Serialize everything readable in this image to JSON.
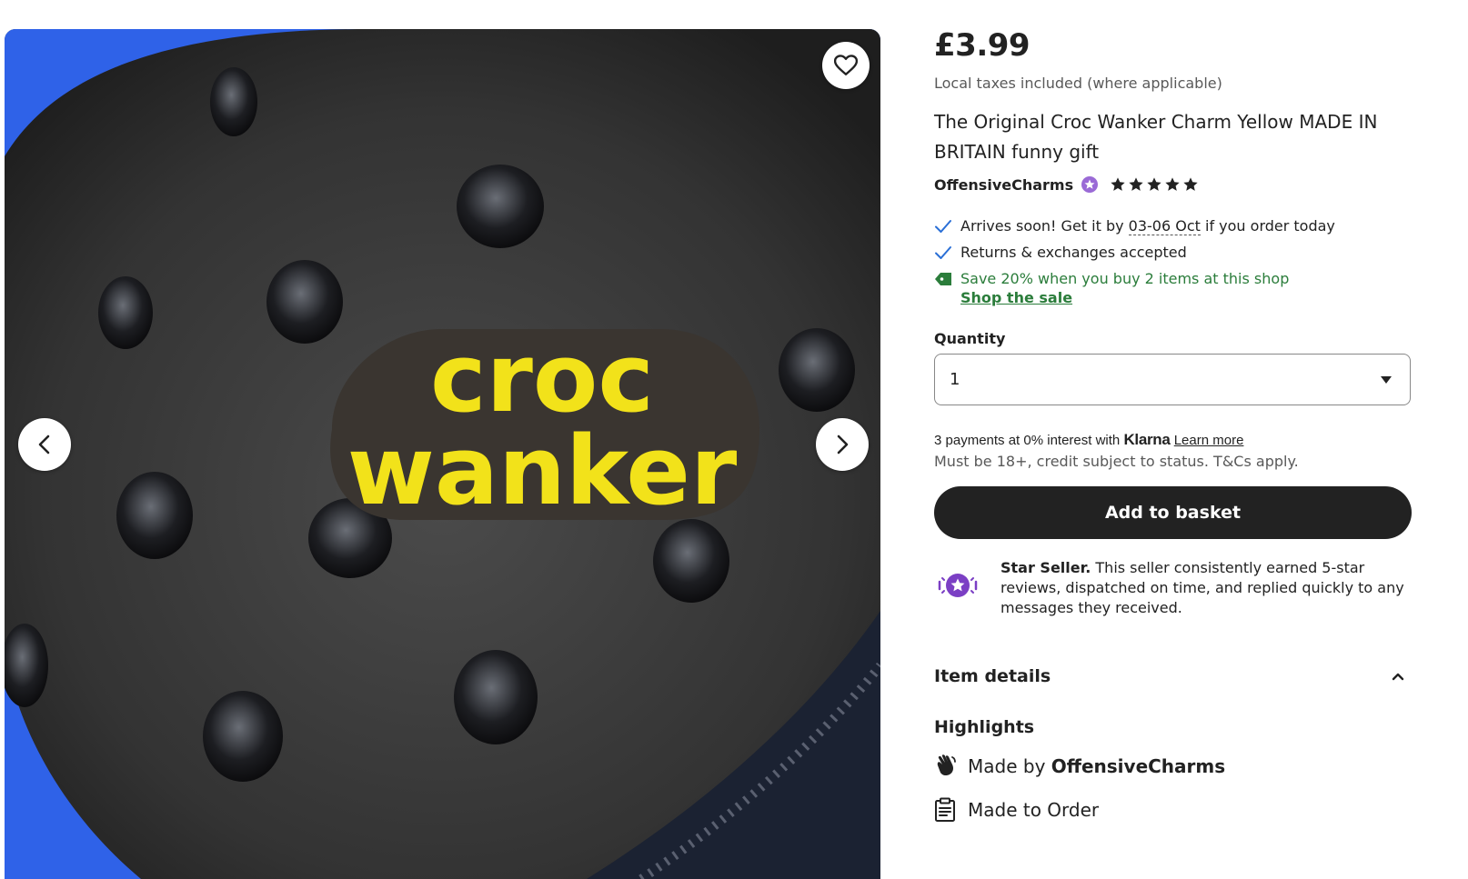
{
  "gallery": {
    "photo_text_line1": "croc",
    "photo_text_line2": "wanker",
    "photo_colors": {
      "background": "#2f62e8",
      "shoe": "#3a3a3a",
      "charm_text": "#f2e21a"
    },
    "favorite_icon": "heart-outline-icon",
    "prev_icon": "chevron-left-icon",
    "next_icon": "chevron-right-icon"
  },
  "listing": {
    "price": "£3.99",
    "taxes_note": "Local taxes included (where applicable)",
    "title": "The Original Croc Wanker Charm Yellow MADE IN BRITAIN funny gift",
    "shop_name": "OffensiveCharms",
    "rating_stars": 5
  },
  "benefits": {
    "arrives_prefix": "Arrives soon! Get it by ",
    "arrives_dates": "03-06 Oct",
    "arrives_suffix": " if you order today",
    "returns": "Returns & exchanges accepted",
    "sale_text": "Save 20% when you buy 2 items at this shop",
    "sale_link": "Shop the sale",
    "sale_color": "#2b7d3b"
  },
  "quantity": {
    "label": "Quantity",
    "selected": "1"
  },
  "klarna": {
    "prefix": "3 payments at 0% interest with ",
    "brand": "Klarna",
    "learn_more": "Learn more",
    "credit_note": "Must be 18+, credit subject to status. T&Cs apply."
  },
  "actions": {
    "add_to_basket": "Add to basket"
  },
  "star_seller": {
    "title": "Star Seller.",
    "text": " This seller consistently earned 5-star reviews, dispatched on time, and replied quickly to any messages they received.",
    "badge_color": "#7b3fc4"
  },
  "item_details": {
    "header": "Item details",
    "highlights_label": "Highlights",
    "made_by_prefix": "Made by ",
    "made_by_shop": "OffensiveCharms",
    "made_to_order": "Made to Order"
  }
}
